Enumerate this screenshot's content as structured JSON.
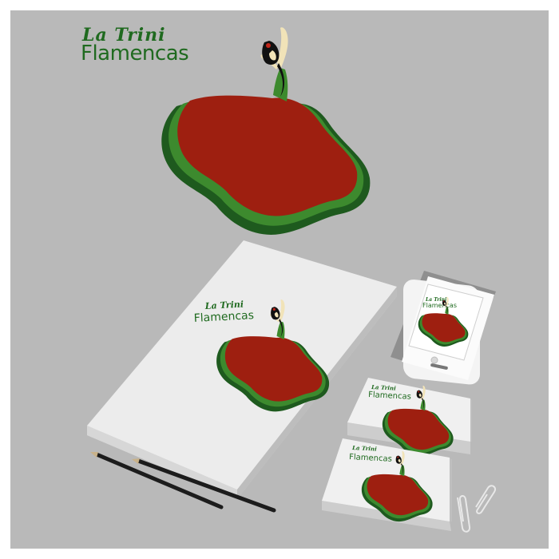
{
  "brand": {
    "line1": "La Trini",
    "line2": "Flamencas"
  },
  "colors": {
    "background": "#b9b9b9",
    "brand_green": "#1f6a1f",
    "skirt_red": "#9e1f10",
    "paper": "#e6e6e6"
  },
  "icons": [
    "flamenco-dancer-icon",
    "pencil-icon",
    "paperclip-icon",
    "smartphone-icon"
  ]
}
